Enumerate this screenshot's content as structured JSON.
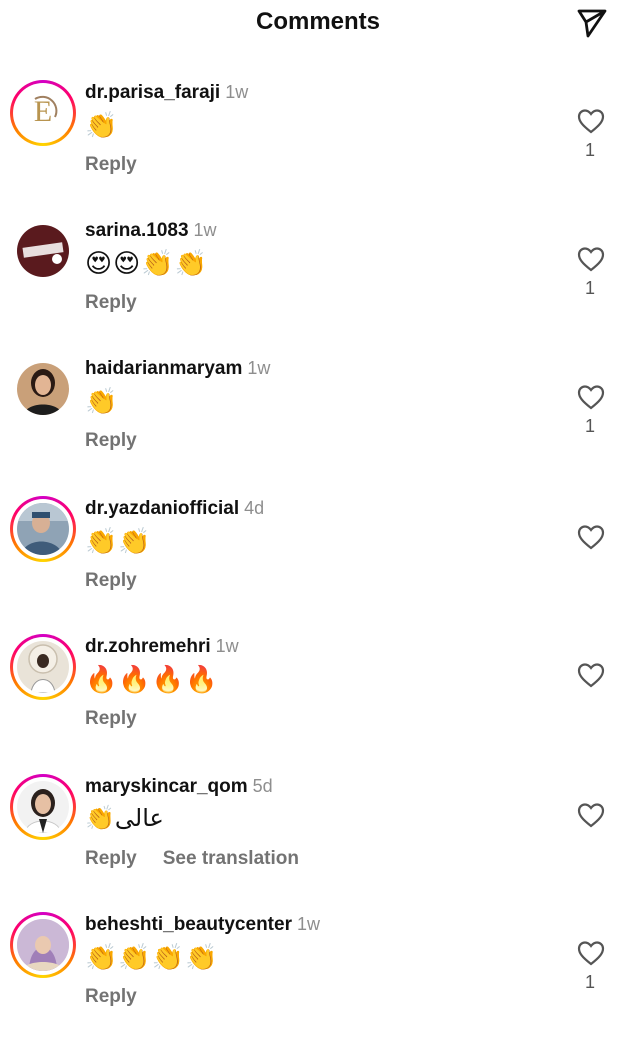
{
  "header": {
    "title": "Comments",
    "send_icon": "paper-plane-icon"
  },
  "colors": {
    "muted": "#737373",
    "time": "#8e8e8e",
    "ring_start": "#d300c5",
    "ring_end": "#ffd600"
  },
  "comments": [
    {
      "username": "dr.parisa_faraji",
      "time": "1w",
      "body": "👏",
      "reply": "Reply",
      "likes": "1"
    },
    {
      "username": "sarina.1083",
      "time": "1w",
      "body": "😍😍👏👏",
      "reply": "Reply",
      "likes": "1"
    },
    {
      "username": "haidarianmaryam",
      "time": "1w",
      "body": "👏",
      "reply": "Reply",
      "likes": "1"
    },
    {
      "username": "dr.yazdaniofficial",
      "time": "4d",
      "body": "👏👏",
      "reply": "Reply",
      "likes": ""
    },
    {
      "username": "dr.zohremehri",
      "time": "1w",
      "body": "🔥🔥🔥🔥",
      "reply": "Reply",
      "likes": ""
    },
    {
      "username": "maryskincar_qom",
      "time": "5d",
      "body": "عالی👏",
      "reply": "Reply",
      "translate": "See translation",
      "likes": ""
    },
    {
      "username": "beheshti_beautycenter",
      "time": "1w",
      "body": "👏👏👏👏",
      "reply": "Reply",
      "likes": "1"
    }
  ]
}
